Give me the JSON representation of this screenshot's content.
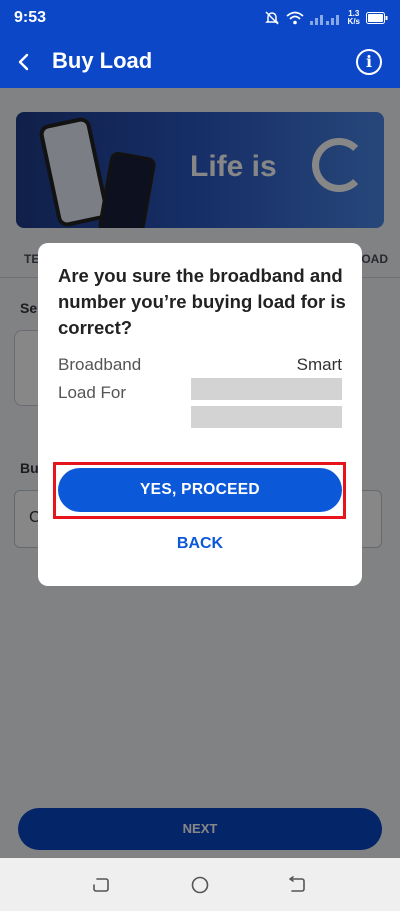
{
  "status_bar": {
    "time": "9:53",
    "speed_value": "1.3",
    "speed_unit": "K/s"
  },
  "app_bar": {
    "title": "Buy Load"
  },
  "banner": {
    "text": "Life is"
  },
  "tabs": {
    "left_partial": "TE",
    "right_partial": "OAD"
  },
  "sections": {
    "select_partial": "Se",
    "buy_partial": "Bu",
    "amount_partial": "C"
  },
  "dialog": {
    "title": "Are you sure the broadband and number you’re buying load for is correct?",
    "broadband_label": "Broadband",
    "broadband_value": "Smart",
    "load_for_label": "Load For",
    "proceed_button": "YES, PROCEED",
    "back_button": "BACK"
  },
  "footer": {
    "next_button": "NEXT"
  },
  "colors": {
    "primary": "#0b47c7",
    "button": "#0b58d8",
    "highlight": "#e8141b"
  }
}
